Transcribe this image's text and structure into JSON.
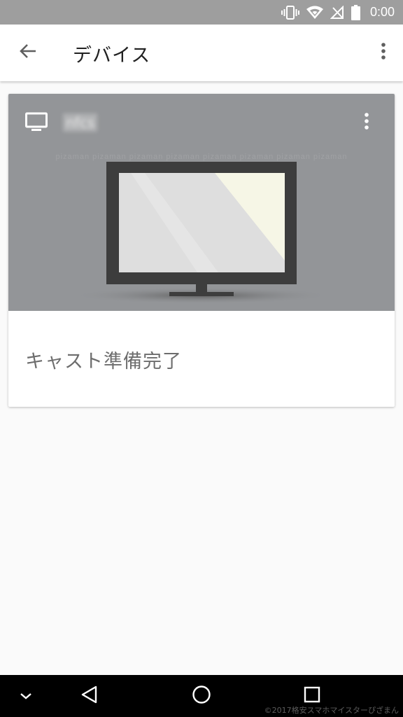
{
  "status_bar": {
    "time": "0:00",
    "icons": [
      "vibrate-icon",
      "wifi-icon",
      "no-signal-icon",
      "battery-icon"
    ]
  },
  "app_bar": {
    "title": "デバイス",
    "back_icon": "arrow-back-icon",
    "menu_icon": "more-vert-icon"
  },
  "device_card": {
    "device_name": "nfcs",
    "device_icon": "tv-icon",
    "menu_icon": "more-vert-icon",
    "watermark": "pizaman pizaman pizaman pizaman pizaman pizaman pizaman pizaman",
    "status": "キャスト準備完了"
  },
  "nav_bar": {
    "buttons": [
      "chevron-down-icon",
      "back-triangle-icon",
      "home-circle-icon",
      "recents-square-icon"
    ]
  },
  "copyright": "©2017格安スマホマイスターぴざまん",
  "colors": {
    "status_bar": "#9e9e9e",
    "card_header": "#939598",
    "screen": "#dedede",
    "screen_highlight": "#f6f6e6",
    "tv_frame": "#3d3d3d"
  }
}
